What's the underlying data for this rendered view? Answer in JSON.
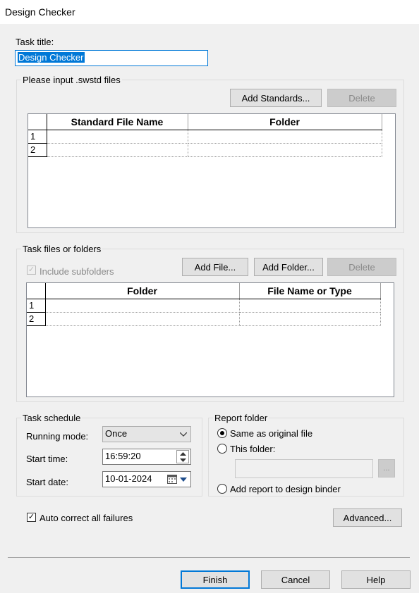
{
  "window": {
    "title": "Design Checker"
  },
  "task_title": {
    "label": "Task title:",
    "value": "Design Checker"
  },
  "standards": {
    "group_title": "Please input .swstd files",
    "add_button": "Add Standards...",
    "delete_button": "Delete",
    "columns": [
      "Standard File Name",
      "Folder"
    ],
    "rows": [
      {
        "num": "1",
        "name": "",
        "folder": ""
      },
      {
        "num": "2",
        "name": "",
        "folder": ""
      }
    ]
  },
  "task_files": {
    "group_title": "Task files or folders",
    "include_subfolders": "Include subfolders",
    "add_file_button": "Add File...",
    "add_folder_button": "Add Folder...",
    "delete_button": "Delete",
    "columns": [
      "Folder",
      "File Name or Type"
    ],
    "rows": [
      {
        "num": "1",
        "folder": "",
        "file": ""
      },
      {
        "num": "2",
        "folder": "",
        "file": ""
      }
    ]
  },
  "schedule": {
    "group_title": "Task schedule",
    "running_mode_label": "Running mode:",
    "running_mode_value": "Once",
    "start_time_label": "Start time:",
    "start_time_value": "16:59:20",
    "start_date_label": "Start date:",
    "start_date_value": "10-01-2024"
  },
  "report": {
    "group_title": "Report folder",
    "same_as_original": "Same as original file",
    "this_folder": "This folder:",
    "folder_value": "",
    "browse_button": "...",
    "add_to_binder": "Add report to design binder"
  },
  "auto_correct": {
    "label": "Auto correct all failures",
    "checked": true
  },
  "advanced_button": "Advanced...",
  "footer": {
    "finish": "Finish",
    "cancel": "Cancel",
    "help": "Help"
  },
  "colors": {
    "accent": "#0078d7",
    "selection": "#0078d7"
  }
}
